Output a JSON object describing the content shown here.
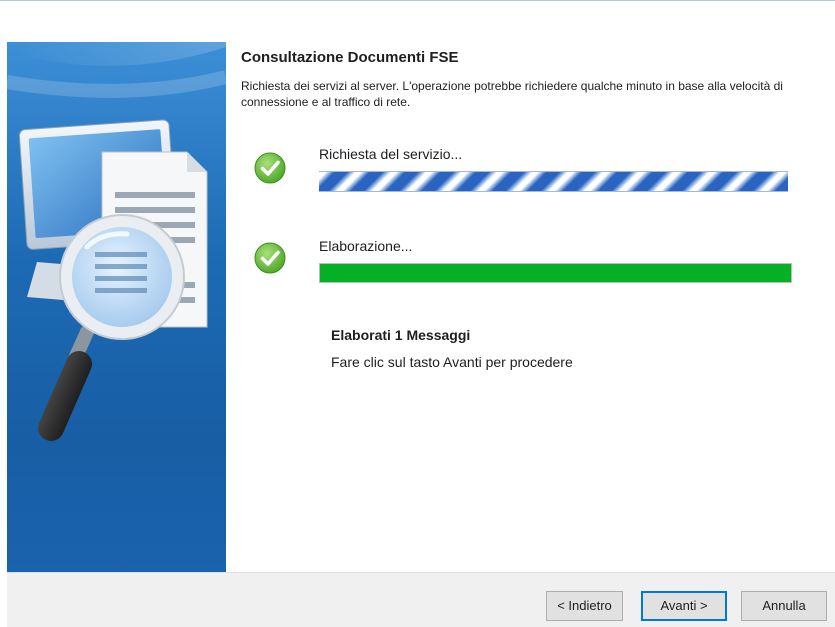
{
  "header": {
    "title": "Consultazione Documenti FSE",
    "description": "Richiesta dei servizi al server. L'operazione potrebbe richiedere qualche minuto in base alla velocità di connessione e al traffico di rete."
  },
  "steps": [
    {
      "label": "Richiesta del servizio...",
      "status": "done",
      "icon": "check-icon",
      "progress": "marquee"
    },
    {
      "label": "Elaborazione...",
      "status": "done",
      "icon": "check-icon",
      "progress": 1.0
    }
  ],
  "result": {
    "title": "Elaborati 1 Messaggi",
    "message": "Fare clic sul tasto Avanti per procedere"
  },
  "buttons": {
    "back": "< Indietro",
    "next": "Avanti >",
    "cancel": "Annulla"
  },
  "colors": {
    "progress_fill": "#06b025",
    "side_panel": "#1d6bb5",
    "check": "#5cb82e"
  },
  "side_image_icon": "document-search-icon"
}
